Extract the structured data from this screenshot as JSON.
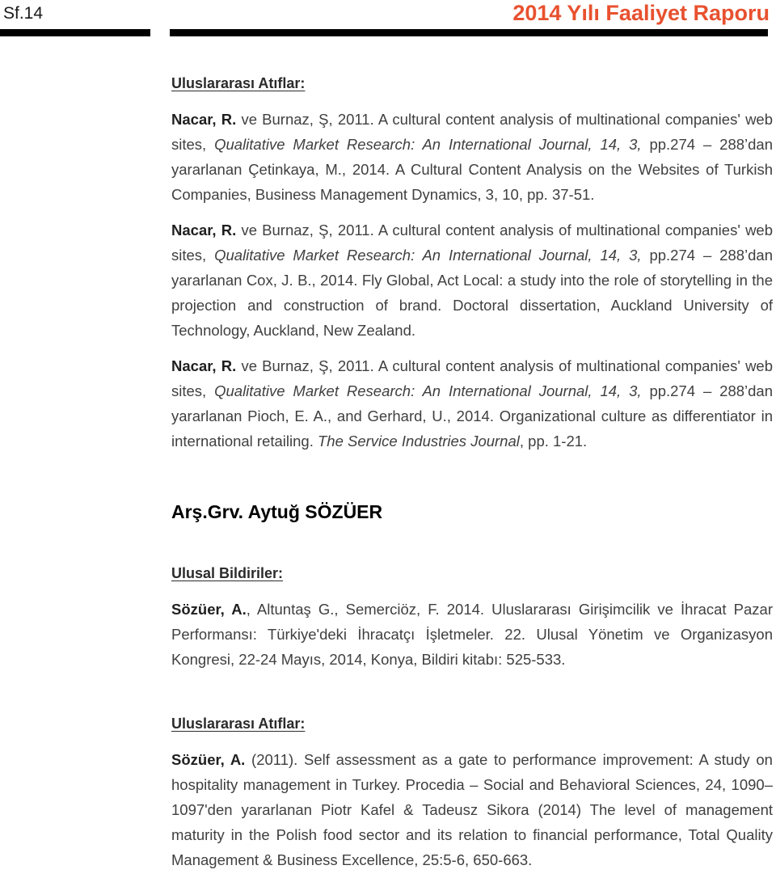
{
  "header": {
    "page_number": "Sf.14",
    "report_title": "2014 Yılı Faaliyet Raporu",
    "title_color": "#E8512F",
    "rule_color": "#000000"
  },
  "sections": {
    "citations_heading_1": "Uluslararası Atıflar:",
    "citation_1": {
      "author_bold": "Nacar, R.",
      "text_a": " ve Burnaz, Ş, 2011. A cultural content analysis of multinational companies' web sites, ",
      "italic_1": "Qualitative Market Research: An International Journal, 14, 3,",
      "text_b": " pp.274 – 288’dan yararlanan Çetinkaya, M., 2014. A Cultural Content Analysis on the Websites of Turkish Companies, Business Management Dynamics, 3, 10, pp. 37-51."
    },
    "citation_2": {
      "author_bold": "Nacar, R.",
      "text_a": " ve Burnaz, Ş, 2011. A cultural content analysis of multinational companies' web sites, ",
      "italic_1": "Qualitative Market Research: An International Journal, 14, 3,",
      "text_b": " pp.274 – 288’dan yararlanan Cox, J. B., 2014. Fly Global, Act Local: a study into the role of storytelling in the projection and construction of brand. Doctoral dissertation, Auckland University of Technology, Auckland, New Zealand."
    },
    "citation_3": {
      "author_bold": "Nacar, R.",
      "text_a": " ve Burnaz, Ş, 2011. A cultural content analysis of multinational companies' web sites, ",
      "italic_1": "Qualitative Market Research: An International Journal, 14, 3,",
      "text_b": " pp.274 – 288’dan yararlanan Pioch, E. A., and Gerhard, U., 2014. Organizational culture as differentiator in international retailing. ",
      "italic_2": "The Service Industries Journal",
      "text_c": ", pp. 1-21."
    },
    "person_heading": "Arş.Grv. Aytuğ SÖZÜER",
    "national_papers_heading": "Ulusal Bildiriler:",
    "national_paper_1": {
      "author_bold": "Sözüer, A.",
      "text_a": ", Altuntaş G., Semerciöz, F. 2014. Uluslararası Girişimcilik ve İhracat Pazar Performansı: Türkiye'deki İhracatçı İşletmeler. 22. Ulusal Yönetim ve Organizasyon Kongresi, 22-24 Mayıs, 2014, Konya, Bildiri kitabı: 525-533."
    },
    "citations_heading_2": "Uluslararası Atıflar:",
    "citation_4": {
      "author_bold": "Sözüer, A.",
      "text_a": " (2011). Self assessment as a gate to performance improvement: A study on hospitality management in Turkey. Procedia – Social and Behavioral Sciences, 24, 1090–1097'den yararlanan Piotr Kafel & Tadeusz Sikora (2014) The level of management maturity in the Polish food sector and its relation to financial performance, Total Quality Management & Business Excellence, 25:5-6, 650-663."
    }
  }
}
